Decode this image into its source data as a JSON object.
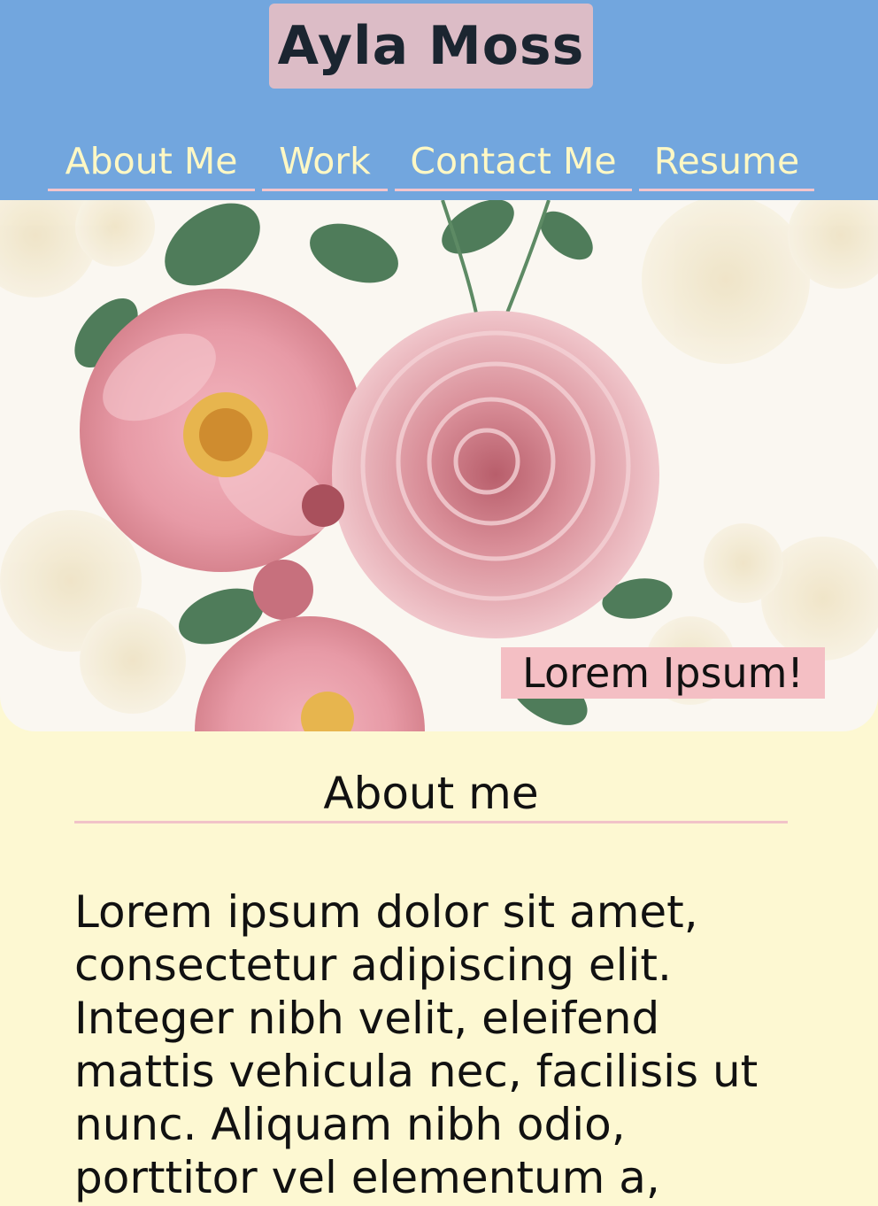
{
  "header": {
    "name": "Ayla Moss",
    "nav": [
      "About Me",
      "Work",
      "Contact Me",
      "Resume"
    ]
  },
  "hero": {
    "caption": "Lorem Ipsum!"
  },
  "about": {
    "title": "About me",
    "text": "Lorem ipsum dolor sit amet, consectetur adipiscing elit. Integer nibh velit, eleifend mattis vehicula nec, facilisis ut nunc. Aliquam nibh odio, porttitor vel elementum a,"
  },
  "colors": {
    "header_bg": "#72a6de",
    "name_bg": "#dcbcc6",
    "nav_text": "#fff8c4",
    "accent_pink": "#f4bfc4",
    "page_bg": "#fdf8d2"
  }
}
